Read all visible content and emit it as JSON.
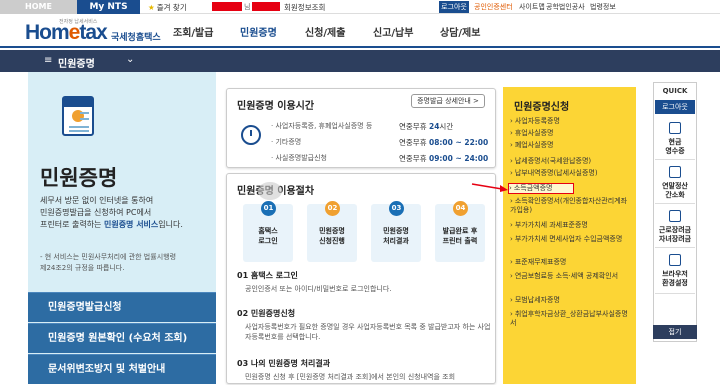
{
  "util": {
    "home": "HOME",
    "my_nts": "My NTS",
    "favorites": "즐겨 찾기",
    "nim": "님",
    "member_info": "회원정보조회",
    "logout": "로그아웃",
    "cert_center": "공인인증센터",
    "sitemap": "사이트맵",
    "biz_cert": "공학법인공사",
    "law": "법령정보"
  },
  "logo": {
    "small_text": "전자정 납세서비스",
    "hom": "Hom",
    "e": "e",
    "tax": "tax",
    "korean": "국세청홈택스"
  },
  "gnb": [
    "조회/발급",
    "민원증명",
    "신청/제출",
    "신고/납부",
    "상담/제보"
  ],
  "lnb": {
    "title": "민원증명"
  },
  "left": {
    "title": "민원증명",
    "desc_1": "세무서 방문 없이 인터넷을 통하여",
    "desc_2": "민원증명발급을 신청하여 PC에서",
    "desc_3": "프린터로 출력하는 ",
    "desc_hl": "민원증명 서비스",
    "desc_4": "입니다.",
    "note_1": "- 현 서비스는 민원사무처리에 관한 법률시행령",
    "note_2": "  제24조2의 규정을 따릅니다.",
    "menu": [
      "민원증명발급신청",
      "민원증명 원본확인 (수요처 조회)",
      "문서위변조방지 및 처벌안내"
    ]
  },
  "time_box": {
    "title": "민원증명 이용시간",
    "guide_btn": "증명발급 상세안내 >",
    "rows": [
      {
        "label": "· 사업자등록증, 휴폐업사실증명 등",
        "val_pre": "연중무휴 ",
        "val_b": "24",
        "val_post": "시간"
      },
      {
        "label": "· 기타증명",
        "val_pre": "연중무휴 ",
        "val_b": "08:00 ~ 22:00",
        "val_post": ""
      },
      {
        "label": "· 사실증명발급신청",
        "val_pre": "연중무휴 ",
        "val_b": "09:00 ~ 24:00",
        "val_post": ""
      }
    ]
  },
  "proc_box": {
    "title": "민원증명 이용절차",
    "steps": [
      {
        "num": "01",
        "label": "홈택스\n로그인"
      },
      {
        "num": "02",
        "label": "민원증명\n신청진행"
      },
      {
        "num": "03",
        "label": "민원증명\n처리결과"
      },
      {
        "num": "04",
        "label": "발급완료 후\n프린터 출력"
      }
    ],
    "items": [
      {
        "title": "01 홈택스 로그인",
        "desc": "공인인증서 또는 아이디/비밀번호로 로그인합니다."
      },
      {
        "title": "02 민원증명신청",
        "desc": "사업자등록번호가 필요한 증명일 경우 사업자등록번호 목록 중 발급받고자 하는 사업자등록번호를 선택합니다."
      },
      {
        "title": "03 나의 민원증명 처리결과",
        "desc": "민원증명 신청 후 [민원증명 처리결과 조회]에서 본인의 신청내역을 조회"
      }
    ]
  },
  "right": {
    "title": "민원증명신청",
    "items": [
      "사업자등록증명",
      "휴업사실증명",
      "폐업사실증명",
      "납세증명서(국세완납증명)",
      "납부내역증명(납세사실증명)",
      "소득금액증명",
      "소득확인증명서(개인종합자산관리계좌 가입용)",
      "부가가치세 과세표준증명",
      "부가가치세 면세사업자 수입금액증명",
      "표준재무제표증명",
      "연금보험료등 소득·세액 공제확인서",
      "모범납세자증명",
      "취업후학자금상환_상환금납부사실증명서"
    ],
    "selected_index": 5
  },
  "quick": {
    "head": "QUICK",
    "logout": "로그아웃",
    "buttons": [
      "현금\n영수증",
      "연말정산\n간소화",
      "근로장려금\n자녀장려금",
      "브라우저\n환경설정"
    ],
    "close": "접기"
  },
  "colors": {
    "brand_blue": "#1a4d8f",
    "nav_dark": "#2d3e5e",
    "panel_yellow": "#fcd535",
    "left_bg": "#d8eef6",
    "menu_blue": "#2d6ca3",
    "highlight_red": "#e60012"
  }
}
